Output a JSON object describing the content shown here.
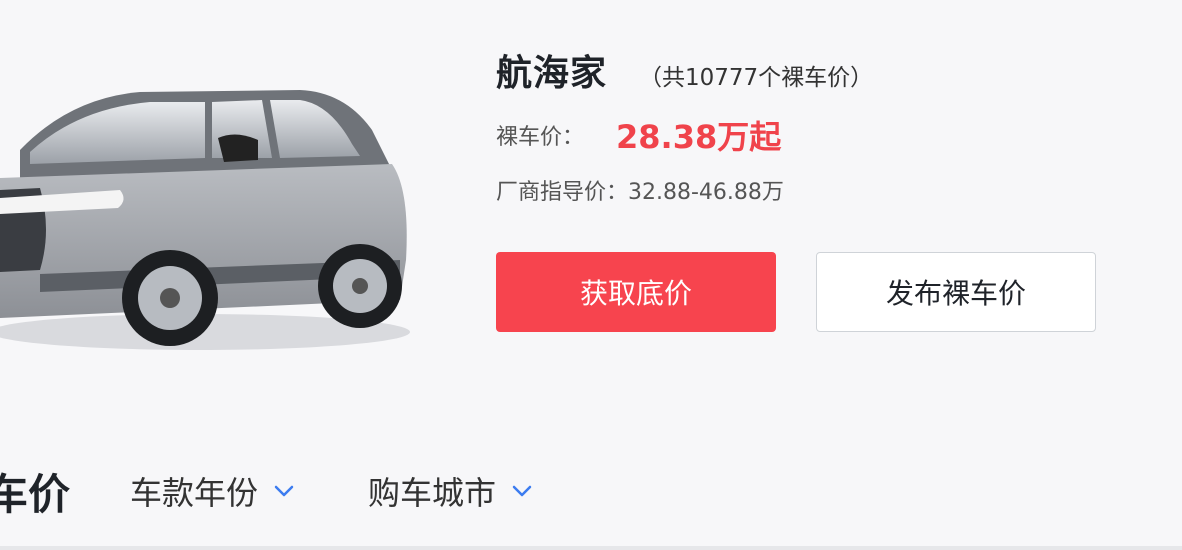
{
  "car": {
    "name": "航海家",
    "count_text": "（共10777个裸车价）",
    "image_icon": "suv-car-image"
  },
  "price": {
    "label": "裸车价：",
    "value": "28.38万起",
    "color": "#f0434b"
  },
  "guide_price": {
    "label": "厂商指导价：",
    "value": "32.88-46.88万"
  },
  "buttons": {
    "primary_label": "获取底价",
    "secondary_label": "发布裸车价"
  },
  "bottom": {
    "section_title": "车价",
    "filters": [
      {
        "label": "车款年份",
        "icon": "chevron-down-icon"
      },
      {
        "label": "购车城市",
        "icon": "chevron-down-icon"
      }
    ],
    "accent": "#3c7cf0"
  }
}
